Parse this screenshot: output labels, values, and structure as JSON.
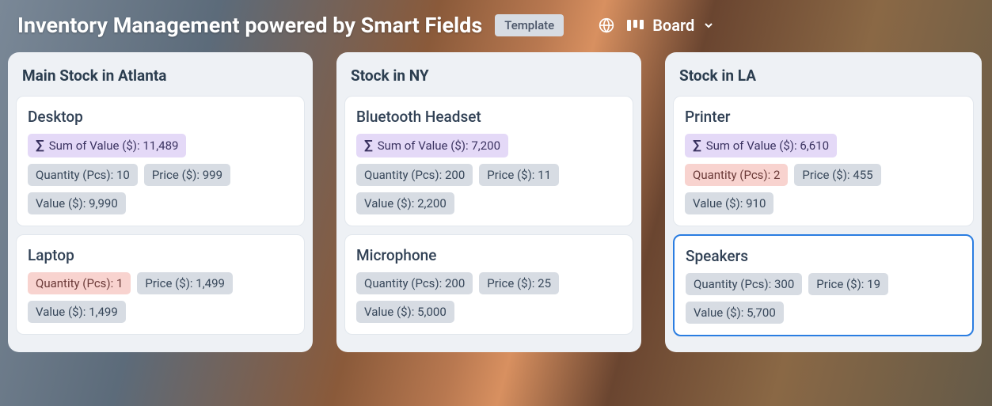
{
  "header": {
    "title": "Inventory Management powered by Smart Fields",
    "template_label": "Template",
    "view_label": "Board"
  },
  "labels": {
    "sum_prefix": "Sum of Value ($): ",
    "quantity_prefix": "Quantity (Pcs): ",
    "price_prefix": "Price ($): ",
    "value_prefix": "Value ($): "
  },
  "columns": [
    {
      "title": "Main Stock in Atlanta",
      "cards": [
        {
          "title": "Desktop",
          "sum": "11,489",
          "quantity": "10",
          "quantity_warn": false,
          "price": "999",
          "value": "9,990",
          "selected": false
        },
        {
          "title": "Laptop",
          "sum": null,
          "quantity": "1",
          "quantity_warn": true,
          "price": "1,499",
          "value": "1,499",
          "selected": false
        }
      ]
    },
    {
      "title": "Stock in NY",
      "cards": [
        {
          "title": "Bluetooth Headset",
          "sum": "7,200",
          "quantity": "200",
          "quantity_warn": false,
          "price": "11",
          "value": "2,200",
          "selected": false
        },
        {
          "title": "Microphone",
          "sum": null,
          "quantity": "200",
          "quantity_warn": false,
          "price": "25",
          "value": "5,000",
          "selected": false
        }
      ]
    },
    {
      "title": "Stock in LA",
      "cards": [
        {
          "title": "Printer",
          "sum": "6,610",
          "quantity": "2",
          "quantity_warn": true,
          "price": "455",
          "value": "910",
          "selected": false
        },
        {
          "title": "Speakers",
          "sum": null,
          "quantity": "300",
          "quantity_warn": false,
          "price": "19",
          "value": "5,700",
          "selected": true
        }
      ]
    }
  ]
}
